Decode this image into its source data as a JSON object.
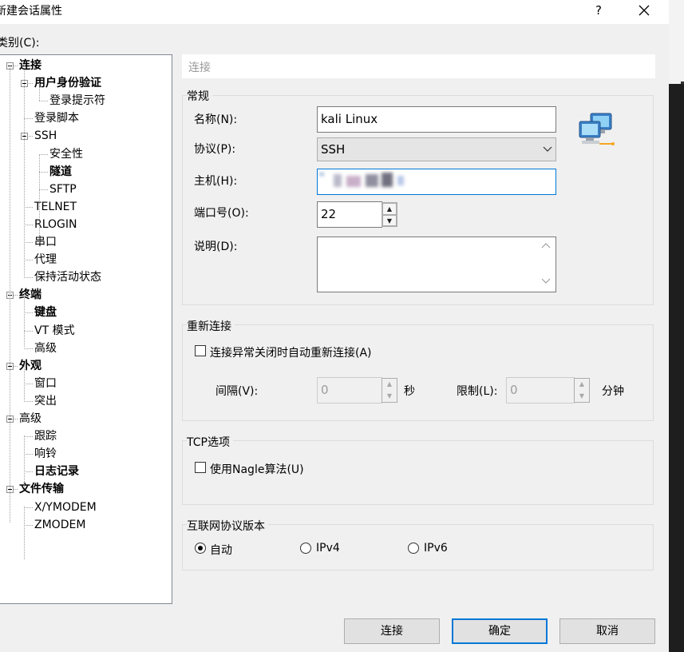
{
  "window": {
    "title": "新建会话属性",
    "help_label": "?",
    "close_label": "✕"
  },
  "category_label": "类别(C):",
  "tree": {
    "items": [
      {
        "label": "连接",
        "bold": true
      },
      {
        "label": "用户身份验证",
        "bold": true
      },
      {
        "label": "登录提示符",
        "bold": false
      },
      {
        "label": "登录脚本",
        "bold": false
      },
      {
        "label": "SSH",
        "bold": false
      },
      {
        "label": "安全性",
        "bold": false
      },
      {
        "label": "隧道",
        "bold": true
      },
      {
        "label": "SFTP",
        "bold": false
      },
      {
        "label": "TELNET",
        "bold": false
      },
      {
        "label": "RLOGIN",
        "bold": false
      },
      {
        "label": "串口",
        "bold": false
      },
      {
        "label": "代理",
        "bold": false
      },
      {
        "label": "保持活动状态",
        "bold": false
      },
      {
        "label": "终端",
        "bold": true
      },
      {
        "label": "键盘",
        "bold": true
      },
      {
        "label": "VT 模式",
        "bold": false
      },
      {
        "label": "高级",
        "bold": false
      },
      {
        "label": "外观",
        "bold": true
      },
      {
        "label": "窗口",
        "bold": false
      },
      {
        "label": "突出",
        "bold": false
      },
      {
        "label": "高级",
        "bold": false
      },
      {
        "label": "跟踪",
        "bold": false
      },
      {
        "label": "响铃",
        "bold": false
      },
      {
        "label": "日志记录",
        "bold": true
      },
      {
        "label": "文件传输",
        "bold": true
      },
      {
        "label": "X/YMODEM",
        "bold": false
      },
      {
        "label": "ZMODEM",
        "bold": false
      }
    ]
  },
  "section_header": "连接",
  "general": {
    "title": "常规",
    "name_label": "名称(N):",
    "name_value": "kali Linux",
    "protocol_label": "协议(P):",
    "protocol_value": "SSH",
    "host_label": "主机(H):",
    "host_value": "",
    "port_label": "端口号(O):",
    "port_value": "22",
    "desc_label": "说明(D):",
    "desc_value": "",
    "icon": "network-computers-icon"
  },
  "reconnect": {
    "title": "重新连接",
    "checkbox_label": "连接异常关闭时自动重新连接(A)",
    "checked": false,
    "interval_label": "间隔(V):",
    "interval_value": "0",
    "interval_unit": "秒",
    "limit_label": "限制(L):",
    "limit_value": "0",
    "limit_unit": "分钟"
  },
  "tcp": {
    "title": "TCP选项",
    "nagle_label": "使用Nagle算法(U)",
    "checked": false
  },
  "ip_version": {
    "title": "互联网协议版本",
    "options": [
      "自动",
      "IPv4",
      "IPv6"
    ],
    "selected": "自动"
  },
  "buttons": {
    "connect": "连接",
    "ok": "确定",
    "cancel": "取消"
  },
  "colors": {
    "accent": "#0078d7",
    "panel": "#f0f0f0"
  }
}
